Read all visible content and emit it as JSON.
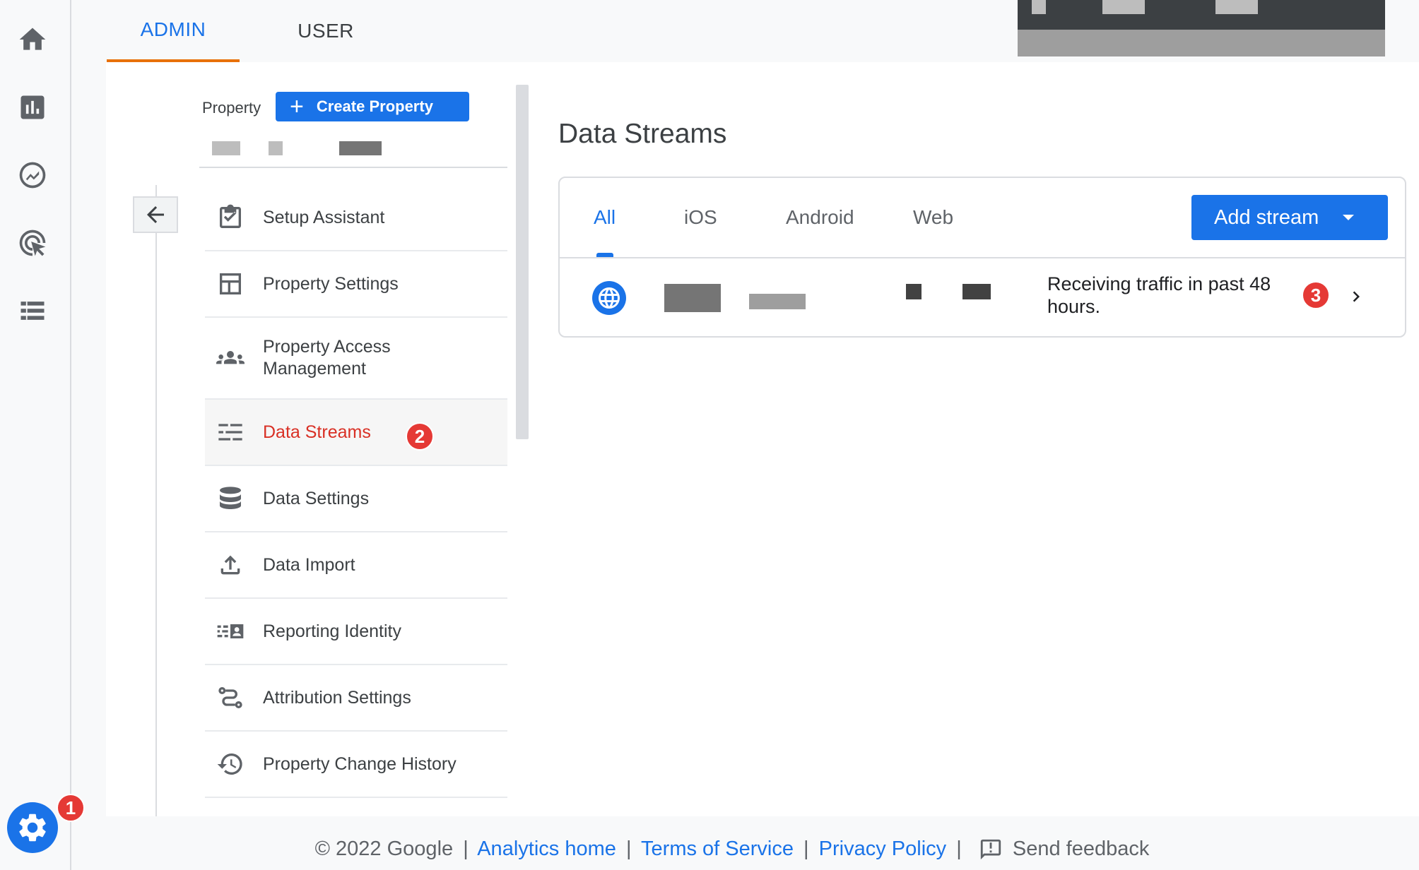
{
  "top_tabs": [
    {
      "label": "ADMIN",
      "active": true
    },
    {
      "label": "USER",
      "active": false
    }
  ],
  "rail": {
    "icons": [
      "home-icon",
      "reports-icon",
      "explore-icon",
      "advertising-icon",
      "list-icon"
    ],
    "settings_icon": "gear-icon",
    "settings_badge": "1"
  },
  "property": {
    "label": "Property",
    "create_button": "Create Property"
  },
  "nav_items": [
    {
      "label": "Setup Assistant",
      "icon": "checklist-icon"
    },
    {
      "label": "Property Settings",
      "icon": "layout-icon"
    },
    {
      "label": "Property Access Management",
      "icon": "people-icon"
    },
    {
      "label": "Data Streams",
      "icon": "streams-icon",
      "active": true,
      "badge": "2"
    },
    {
      "label": "Data Settings",
      "icon": "database-icon"
    },
    {
      "label": "Data Import",
      "icon": "upload-icon"
    },
    {
      "label": "Reporting Identity",
      "icon": "identity-icon"
    },
    {
      "label": "Attribution Settings",
      "icon": "attribution-icon"
    },
    {
      "label": "Property Change History",
      "icon": "history-icon"
    }
  ],
  "data_streams": {
    "title": "Data Streams",
    "tabs": [
      "All",
      "iOS",
      "Android",
      "Web"
    ],
    "active_tab": "All",
    "add_stream_label": "Add stream",
    "stream": {
      "icon": "globe-icon",
      "status": "Receiving traffic in past 48 hours.",
      "badge": "3"
    }
  },
  "footer": {
    "copyright": "© 2022 Google",
    "links": [
      "Analytics home",
      "Terms of Service",
      "Privacy Policy"
    ],
    "feedback": "Send feedback"
  },
  "colors": {
    "accent": "#1a73e8",
    "active_nav_text": "#d93025",
    "tab_underline": "#e8710a",
    "badge": "#e53935"
  }
}
